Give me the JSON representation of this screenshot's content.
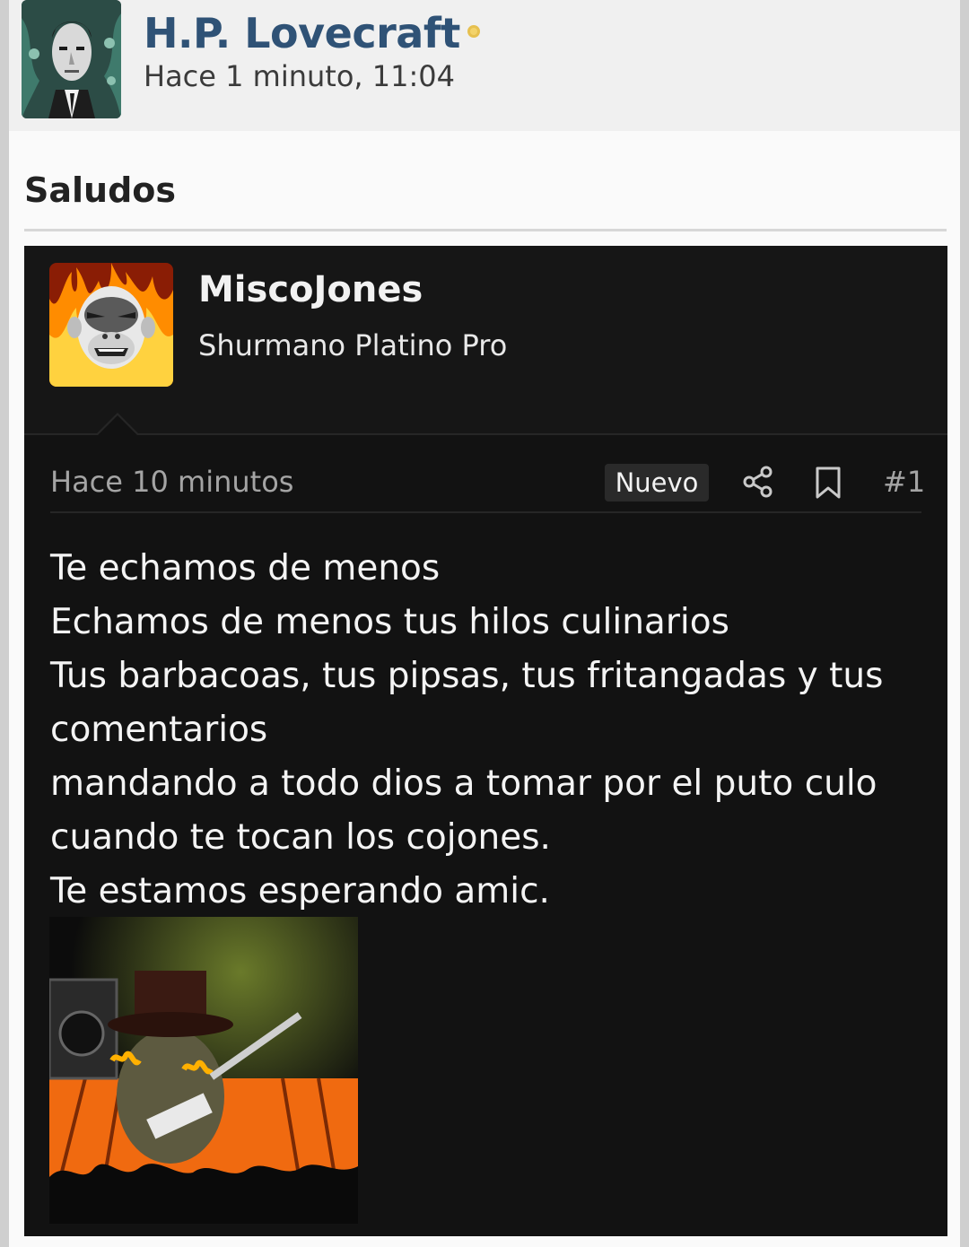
{
  "thread_header": {
    "author": "H.P. Lovecraft",
    "timestamp": "Hace 1 minuto, 11:04"
  },
  "section": {
    "title": "Saludos"
  },
  "post": {
    "author": "MiscoJones",
    "rank": "Shurmano Platino Pro",
    "time": "Hace 10 minutos",
    "badge": "Nuevo",
    "number": "#1",
    "lines": [
      "Te echamos de menos",
      "Echamos de menos tus hilos culinarios",
      "Tus barbacoas, tus pipsas, tus fritangadas y tus",
      "comentarios",
      "mandando a todo dios a tomar por el puto culo",
      "cuando te tocan los cojones.",
      "Te estamos esperando amic."
    ]
  },
  "icons": {
    "online": "online-status-icon",
    "share": "share-icon",
    "bookmark": "bookmark-icon"
  },
  "colors": {
    "author_link": "#2f5276",
    "post_background": "#121212",
    "online_dot": "#f3d36b"
  }
}
